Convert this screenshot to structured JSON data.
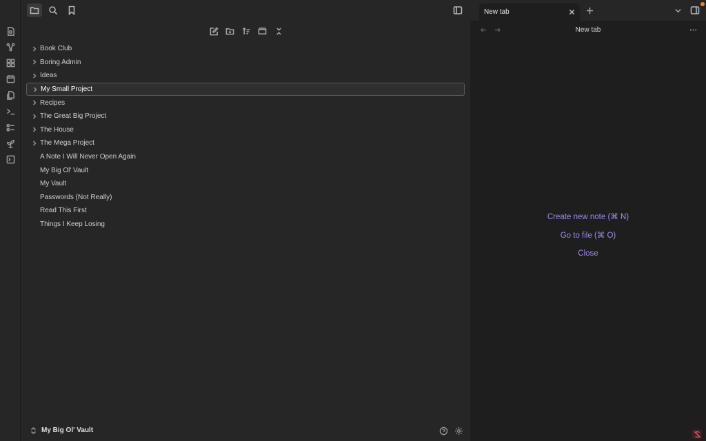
{
  "ribbon": {
    "icons": [
      "open-quick-switcher-icon",
      "graph-view-icon",
      "canvas-icon",
      "daily-note-icon",
      "templates-icon",
      "command-palette-icon",
      "bases-icon",
      "plugin-icon",
      "terminal-icon"
    ]
  },
  "sidebar": {
    "tabs": [
      "files-icon",
      "search-icon",
      "bookmarks-icon"
    ],
    "actions": [
      "new-note-icon",
      "new-folder-icon",
      "sort-icon",
      "auto-reveal-icon",
      "collapse-all-icon"
    ],
    "folders": [
      {
        "label": "Book Club"
      },
      {
        "label": "Boring Admin"
      },
      {
        "label": "Ideas"
      },
      {
        "label": "My Small Project"
      },
      {
        "label": "Recipes"
      },
      {
        "label": "The Great Big Project"
      },
      {
        "label": "The House"
      },
      {
        "label": "The Mega Project"
      }
    ],
    "files": [
      {
        "label": "A Note I Will Never Open Again"
      },
      {
        "label": "My Big Ol' Vault"
      },
      {
        "label": "My Vault"
      },
      {
        "label": "Passwords (Not Really)"
      },
      {
        "label": "Read This First"
      },
      {
        "label": "Things I Keep Losing"
      }
    ],
    "selected_index": 3,
    "vault_name": "My Big Ol' Vault"
  },
  "main": {
    "tab_title": "New tab",
    "view_title": "New tab",
    "actions": {
      "create": "Create new note (⌘ N)",
      "goto": "Go to file (⌘ O)",
      "close": "Close"
    },
    "accent": "#a28ae5",
    "notification_dot": "#e8862a"
  }
}
